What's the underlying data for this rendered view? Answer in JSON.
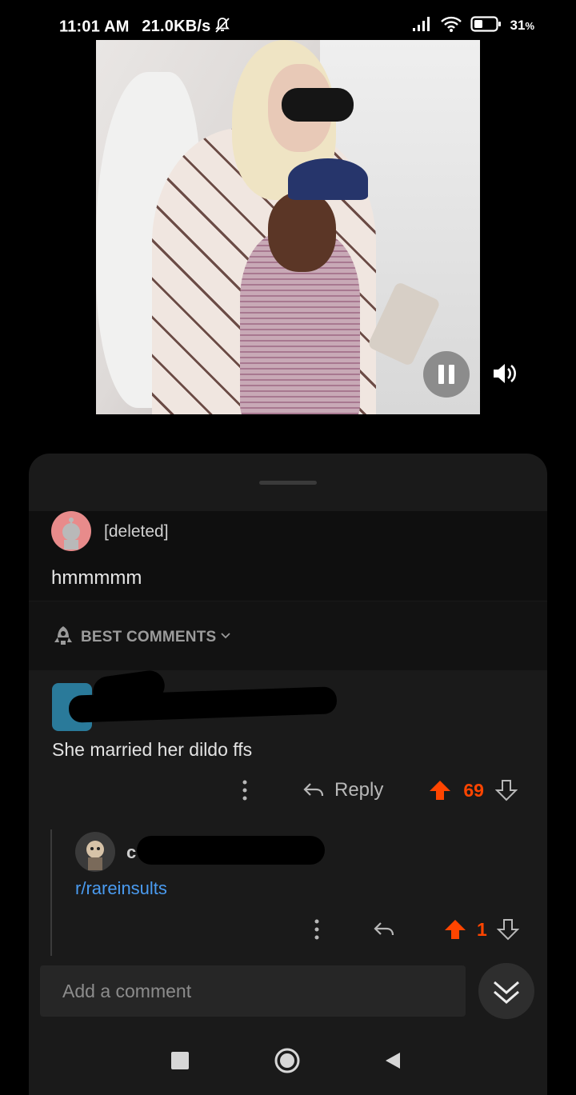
{
  "status_bar": {
    "time": "11:01 AM",
    "speed": "21.0KB/s",
    "battery": "31",
    "battery_unit": "%"
  },
  "video": {
    "playing": true,
    "controls": [
      "pause-icon",
      "volume-icon"
    ]
  },
  "post": {
    "author": "[deleted]",
    "body": "hmmmmm"
  },
  "sort": {
    "label": "BEST COMMENTS",
    "icon": "rocket-icon"
  },
  "comments": [
    {
      "author_visible": "",
      "body": "She married her dildo ffs",
      "reply_label": "Reply",
      "score": "69"
    },
    {
      "author_visible": "c",
      "body": "r/rareinsults",
      "score": "1"
    }
  ],
  "composer": {
    "placeholder": "Add a comment"
  },
  "colors": {
    "accent": "#ff4500",
    "link": "#4a9bf0",
    "sheet": "#1a1a1a",
    "background": "#000000"
  }
}
